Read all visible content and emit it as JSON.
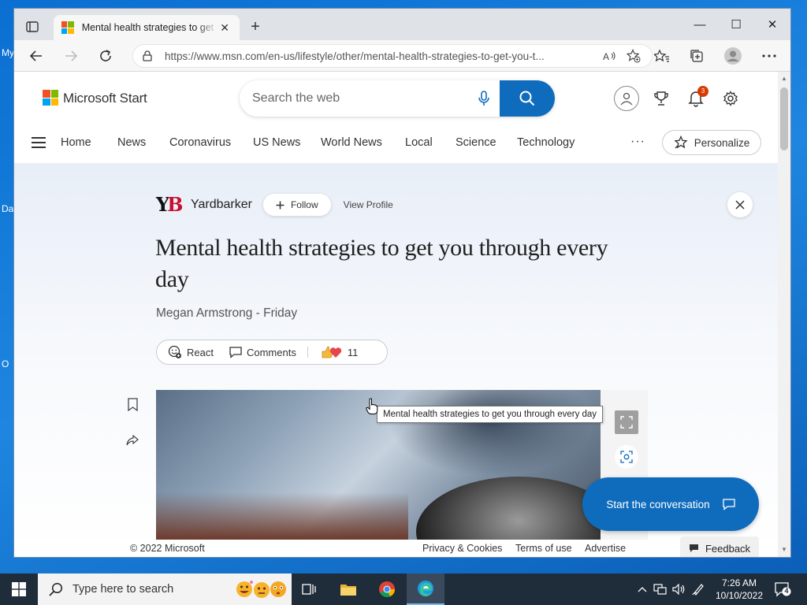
{
  "desktop": {
    "fragments": [
      "My",
      "Da",
      "O"
    ]
  },
  "browser": {
    "tab_title": "Mental health strategies to get you through every day",
    "tab_close": "✕",
    "new_tab": "+",
    "url": "https://www.msn.com/en-us/lifestyle/other/mental-health-strategies-to-get-you-t...",
    "window_controls": {
      "minimize": "—",
      "maximize": "☐",
      "close": "✕"
    }
  },
  "msn": {
    "brand": "Microsoft Start",
    "search_placeholder": "Search the web",
    "notification_count": "3",
    "nav_items": [
      "Home",
      "News",
      "Coronavirus",
      "US News",
      "World News",
      "Local",
      "Science",
      "Technology"
    ],
    "more": "···",
    "personalize": "Personalize"
  },
  "article": {
    "source": "Yardbarker",
    "source_logo": {
      "y": "Y",
      "b": "B"
    },
    "follow": "Follow",
    "view_profile": "View Profile",
    "headline": "Mental health strategies to get you through every day",
    "byline": "Megan Armstrong - Friday",
    "react": "React",
    "comments": "Comments",
    "reaction_count": "11",
    "image_tooltip": "Mental health strategies to get you through every day",
    "conversation": "Start the conversation"
  },
  "footer": {
    "copyright": "© 2022 Microsoft",
    "privacy": "Privacy & Cookies",
    "terms": "Terms of use",
    "advertise": "Advertise",
    "feedback": "Feedback"
  },
  "taskbar": {
    "search_placeholder": "Type here to search",
    "time": "7:26 AM",
    "date": "10/10/2022",
    "notifications": "4"
  },
  "colors": {
    "accent": "#0f6cbd",
    "badge": "#d83b01",
    "ms_red": "#f25022",
    "ms_green": "#7fba00",
    "ms_blue": "#00a4ef",
    "ms_yellow": "#ffb900"
  }
}
